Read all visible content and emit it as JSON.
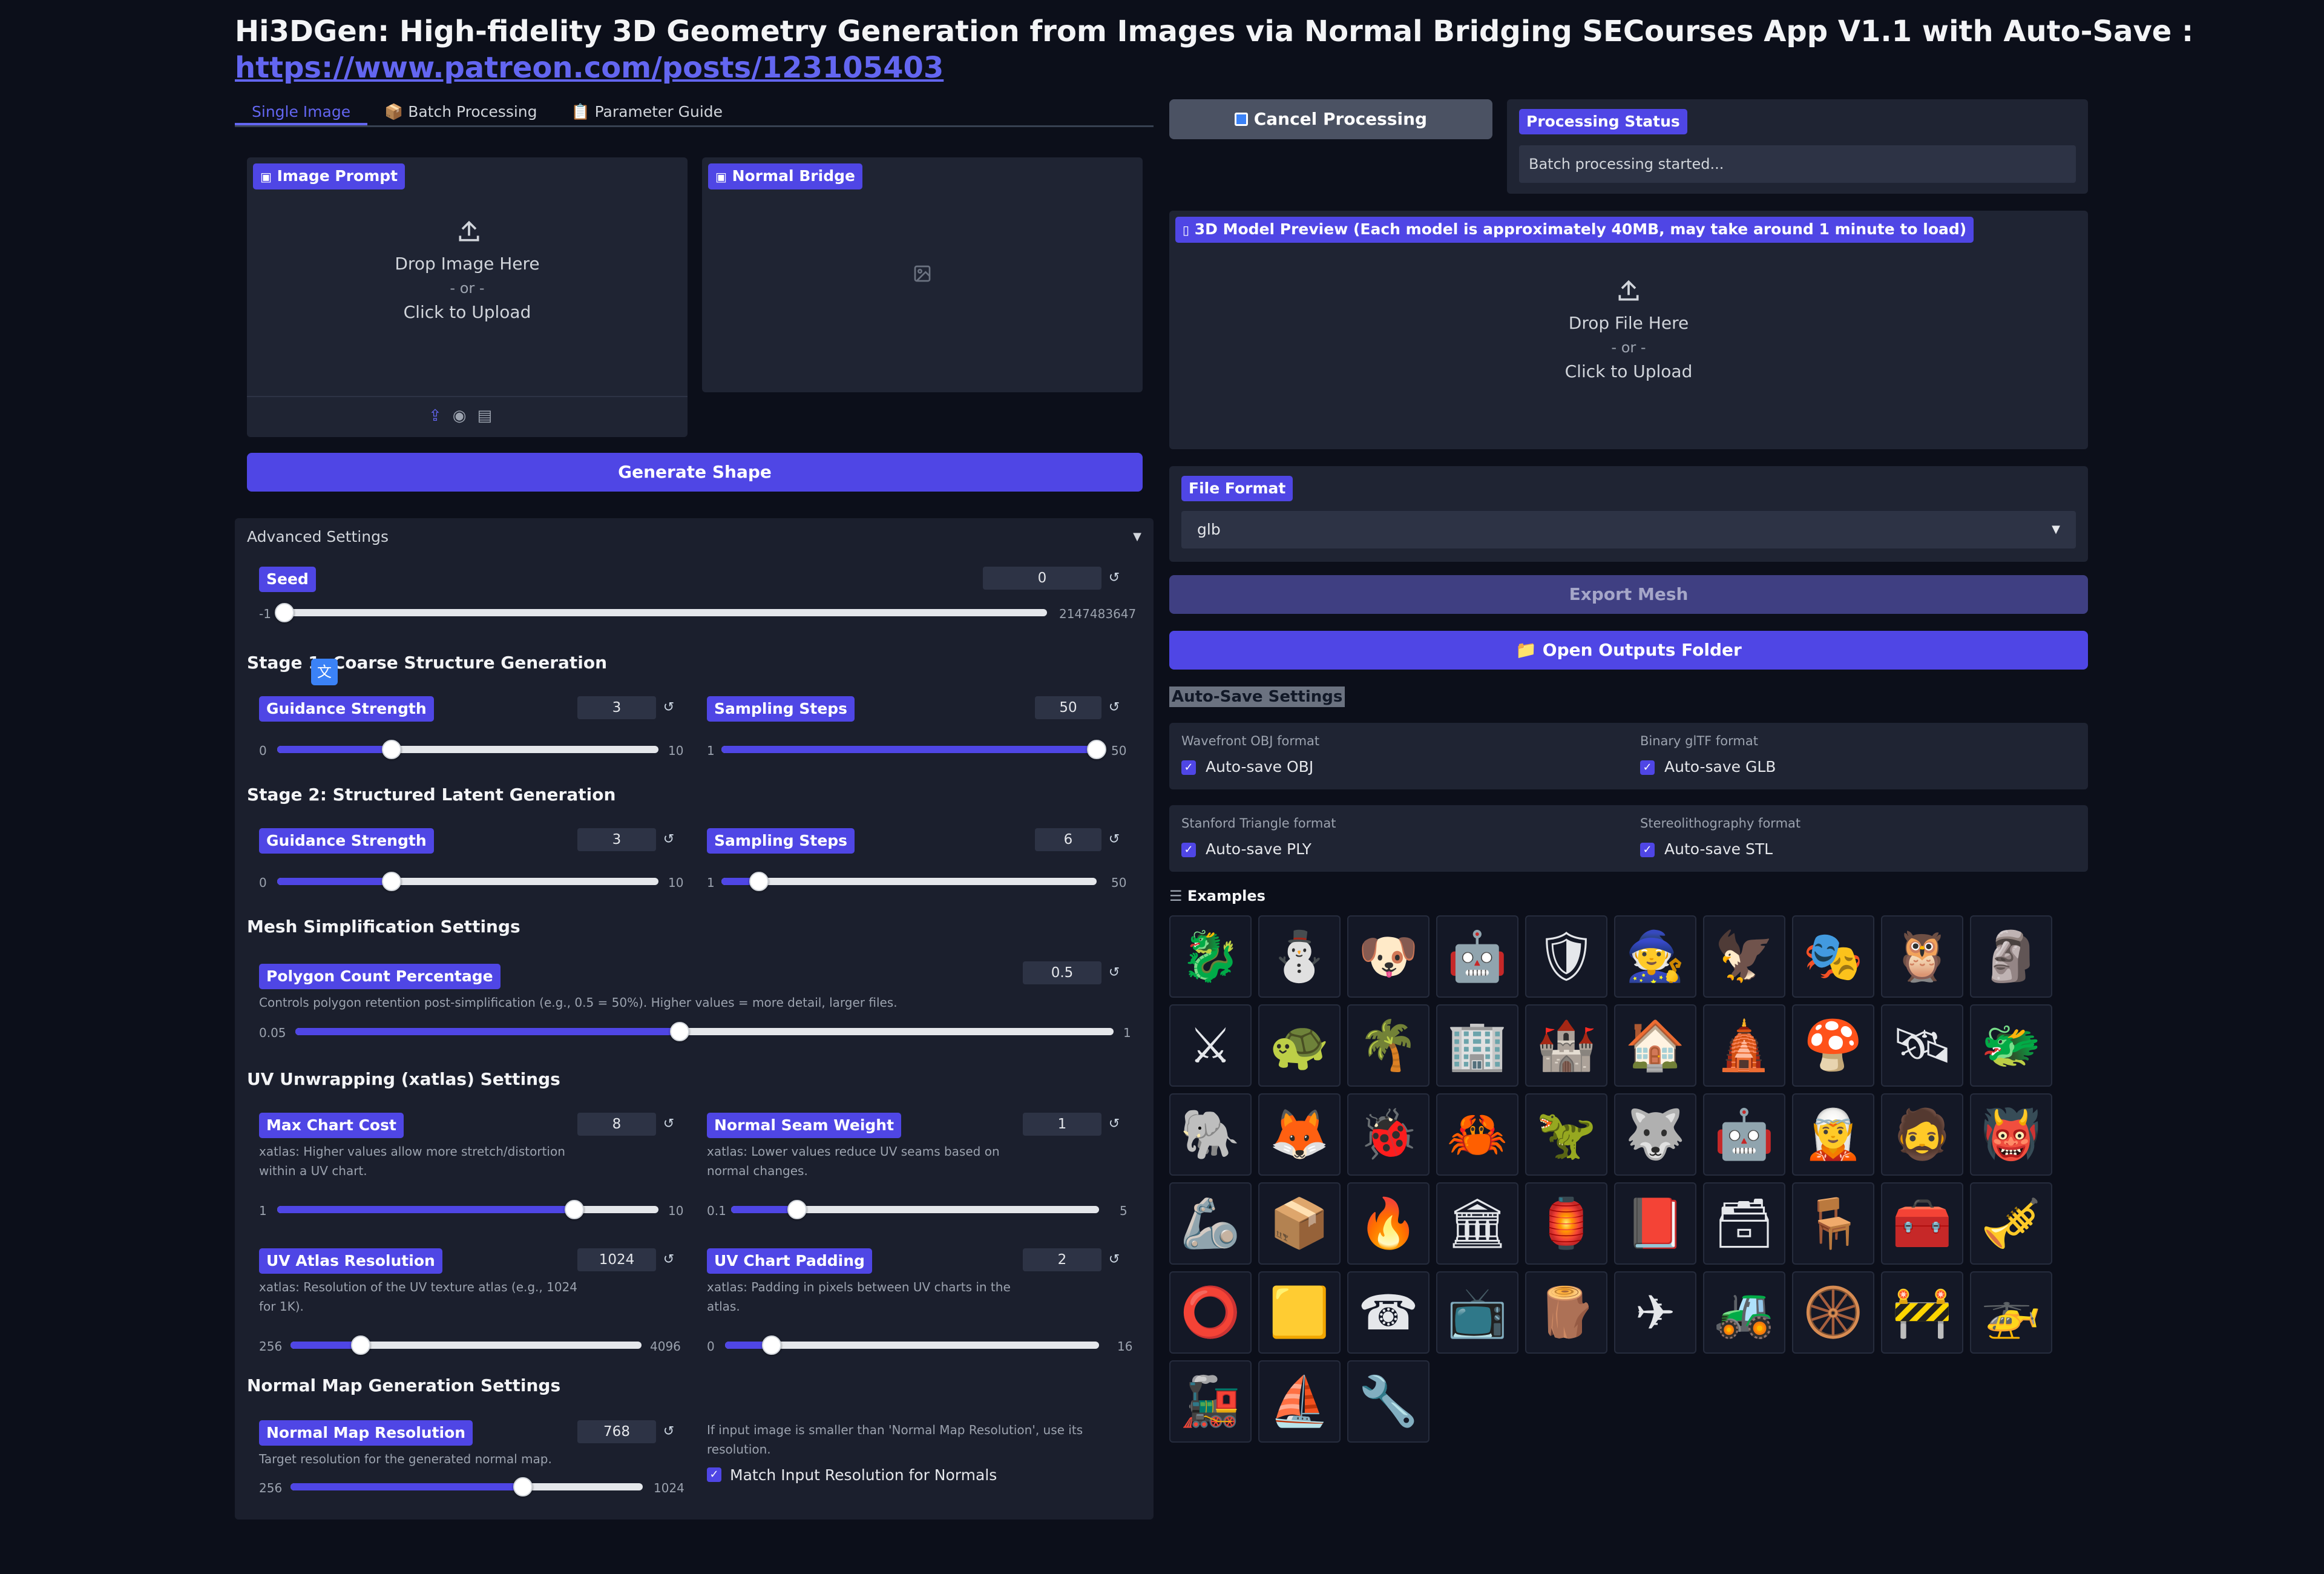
{
  "header": {
    "title": "Hi3DGen: High-fidelity 3D Geometry Generation from Images via Normal Bridging SECourses App V1.1 with Auto-Save :",
    "link": "https://www.patreon.com/posts/123105403"
  },
  "tabs": [
    {
      "label": "Single Image",
      "icon": "",
      "active": true
    },
    {
      "label": "Batch Processing",
      "icon": "📦"
    },
    {
      "label": "Parameter Guide",
      "icon": "📋"
    }
  ],
  "image_prompt": {
    "label": "Image Prompt",
    "drop": "Drop Image Here",
    "or": "- or -",
    "click": "Click to Upload"
  },
  "normal_bridge": {
    "label": "Normal Bridge"
  },
  "generate_button": "Generate Shape",
  "cancel_button": "Cancel Processing",
  "processing_status": {
    "label": "Processing Status",
    "value": "Batch processing started..."
  },
  "model_preview": {
    "label": "3D Model Preview (Each model is approximately 40MB, may take around 1 minute to load)",
    "drop": "Drop File Here",
    "or": "- or -",
    "click": "Click to Upload"
  },
  "file_format": {
    "label": "File Format",
    "value": "glb"
  },
  "export_button": "Export Mesh",
  "open_folder_button": "Open Outputs Folder",
  "open_folder_icon": "📁",
  "autosave": {
    "title": "Auto-Save Settings",
    "items": [
      {
        "caption": "Wavefront OBJ format",
        "label": "Auto-save OBJ",
        "checked": true
      },
      {
        "caption": "Binary glTF format",
        "label": "Auto-save GLB",
        "checked": true
      },
      {
        "caption": "Stanford Triangle format",
        "label": "Auto-save PLY",
        "checked": true
      },
      {
        "caption": "Stereolithography format",
        "label": "Auto-save STL",
        "checked": true
      }
    ]
  },
  "examples": {
    "title": "Examples",
    "items": [
      "🐉",
      "⛄",
      "🐶",
      "🤖",
      "🛡",
      "🧙",
      "🦅",
      "🎭",
      "🦉",
      "🗿",
      "⚔",
      "🐢",
      "🌴",
      "🏢",
      "🏰",
      "🏠",
      "🛕",
      "🍄",
      "🛰",
      "🐲",
      "🐘",
      "🦊",
      "🐞",
      "🦀",
      "🦖",
      "🐺",
      "🤖",
      "🧝",
      "🧔",
      "👹",
      "🦾",
      "📦",
      "🔥",
      "🏛",
      "🏮",
      "📕",
      "🗃",
      "🪑",
      "🧰",
      "🎺",
      "⭕",
      "🟨",
      "☎",
      "📺",
      "🪵",
      "✈",
      "🚜",
      "🛞",
      "🚧",
      "🚁",
      "🚂",
      "⛵",
      "🔧"
    ]
  },
  "advanced": {
    "title": "Advanced Settings",
    "seed": {
      "label": "Seed",
      "value": "0",
      "min": "-1",
      "max": "2147483647",
      "fraction": 0.0
    },
    "stage1": {
      "title": "Stage 1: Coarse Structure Generation",
      "guidance": {
        "label": "Guidance Strength",
        "value": "3",
        "min": "0",
        "max": "10",
        "fraction": 0.3
      },
      "steps": {
        "label": "Sampling Steps",
        "value": "50",
        "min": "1",
        "max": "50",
        "fraction": 1.0
      }
    },
    "stage2": {
      "title": "Stage 2: Structured Latent Generation",
      "guidance": {
        "label": "Guidance Strength",
        "value": "3",
        "min": "0",
        "max": "10",
        "fraction": 0.3
      },
      "steps": {
        "label": "Sampling Steps",
        "value": "6",
        "min": "1",
        "max": "50",
        "fraction": 0.1
      }
    },
    "mesh": {
      "title": "Mesh Simplification Settings",
      "polygon": {
        "label": "Polygon Count Percentage",
        "value": "0.5",
        "desc": "Controls polygon retention post-simplification (e.g., 0.5 = 50%). Higher values = more detail, larger files.",
        "min": "0.05",
        "max": "1",
        "fraction": 0.47
      }
    },
    "uv": {
      "title": "UV Unwrapping (xatlas) Settings",
      "max_chart_cost": {
        "label": "Max Chart Cost",
        "value": "8",
        "desc": "xatlas: Higher values allow more stretch/distortion within a UV chart.",
        "min": "1",
        "max": "10",
        "fraction": 0.78
      },
      "normal_seam": {
        "label": "Normal Seam Weight",
        "value": "1",
        "desc": "xatlas: Lower values reduce UV seams based on normal changes.",
        "min": "0.1",
        "max": "5",
        "fraction": 0.18
      },
      "atlas_res": {
        "label": "UV Atlas Resolution",
        "value": "1024",
        "desc": "xatlas: Resolution of the UV texture atlas (e.g., 1024 for 1K).",
        "min": "256",
        "max": "4096",
        "fraction": 0.2
      },
      "chart_pad": {
        "label": "UV Chart Padding",
        "value": "2",
        "desc": "xatlas: Padding in pixels between UV charts in the atlas.",
        "min": "0",
        "max": "16",
        "fraction": 0.125
      }
    },
    "normal_map": {
      "title": "Normal Map Generation Settings",
      "res": {
        "label": "Normal Map Resolution",
        "value": "768",
        "desc": "Target resolution for the generated normal map.",
        "min": "256",
        "max": "1024",
        "fraction": 0.66
      },
      "match_desc": "If input image is smaller than 'Normal Map Resolution', use its resolution.",
      "match_label": "Match Input Resolution for Normals",
      "match_checked": true
    }
  },
  "colors": {
    "accent": "#4f46e5",
    "bg": "#0c0f1a",
    "panel": "#1f2433"
  }
}
